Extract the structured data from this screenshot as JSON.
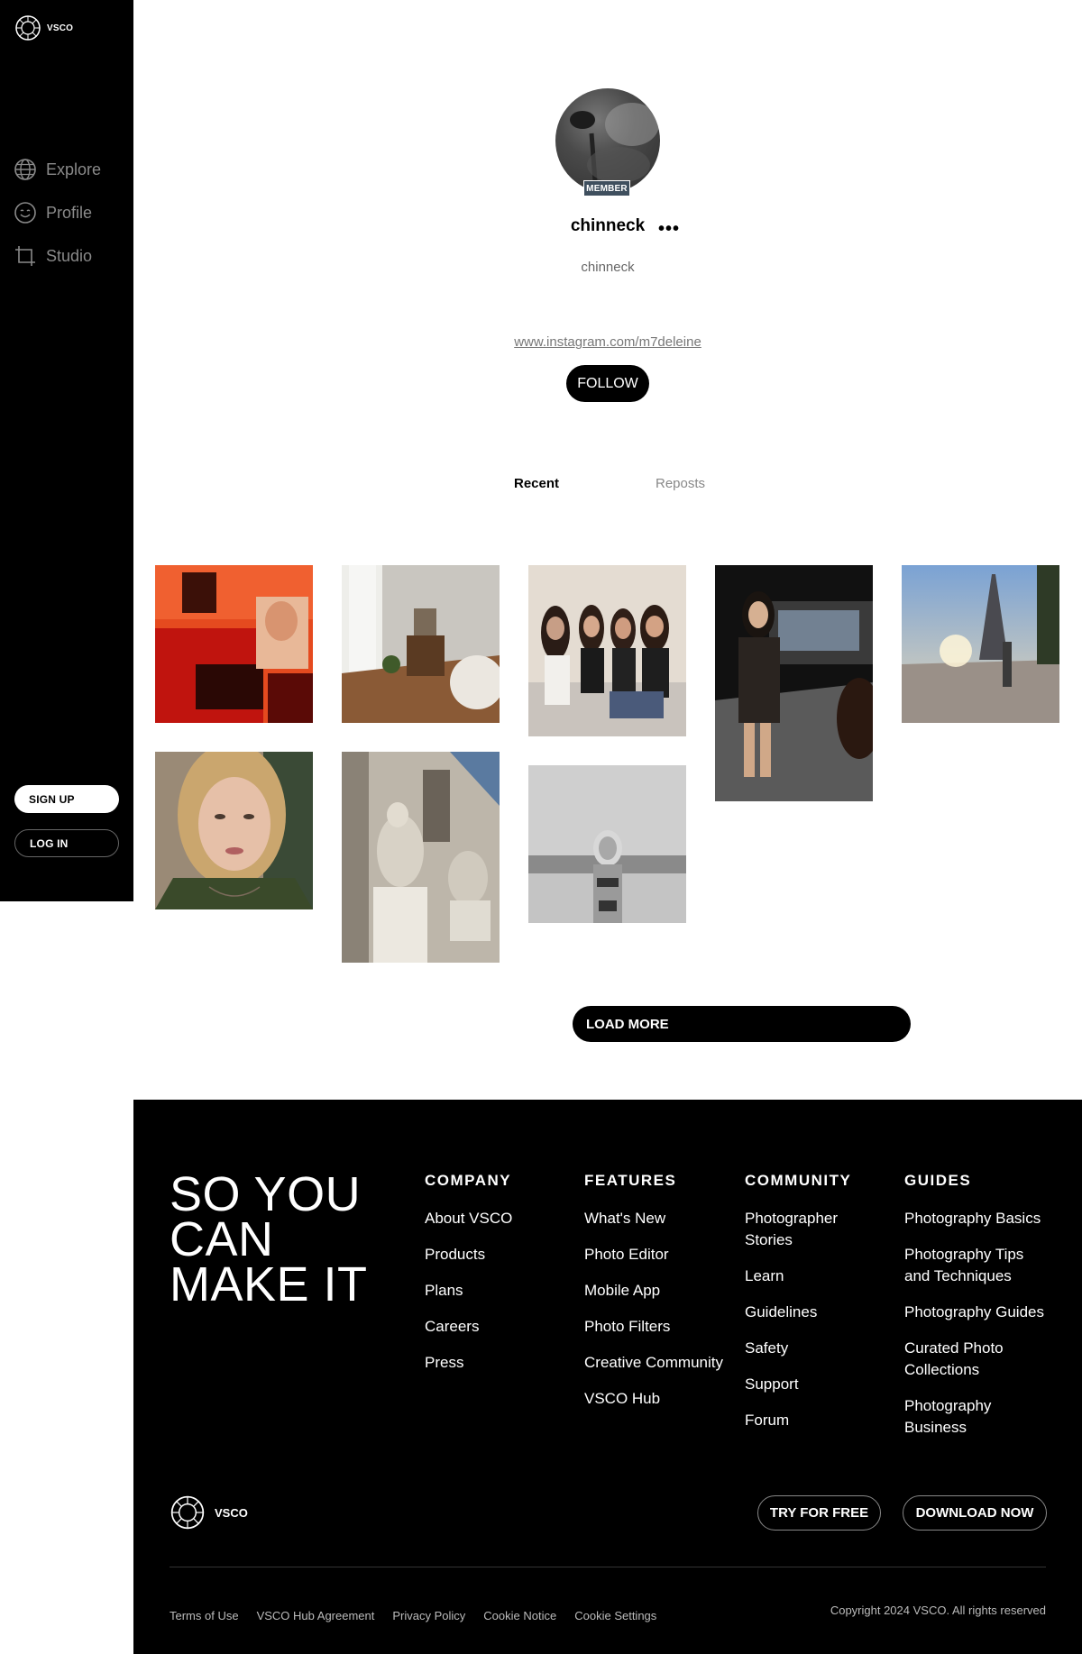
{
  "sidebar": {
    "brand": "VSCO",
    "nav": [
      {
        "label": "Explore",
        "icon": "globe-icon"
      },
      {
        "label": "Profile",
        "icon": "smiley-icon"
      },
      {
        "label": "Studio",
        "icon": "crop-icon"
      }
    ],
    "signup_label": "SIGN UP",
    "login_label": "LOG IN"
  },
  "profile": {
    "badge": "MEMBER",
    "username": "chinneck",
    "more_label": "•••",
    "display_name": "chinneck",
    "link": "www.instagram.com/m7deleine",
    "follow_label": "FOLLOW"
  },
  "tabs": {
    "recent": "Recent",
    "reposts": "Reposts"
  },
  "gallery": {
    "load_more_label": "LOAD MORE"
  },
  "footer": {
    "tagline": "SO YOU CAN MAKE IT",
    "columns": [
      {
        "heading": "COMPANY",
        "links": [
          "About VSCO",
          "Products",
          "Plans",
          "Careers",
          "Press"
        ]
      },
      {
        "heading": "FEATURES",
        "links": [
          "What's New",
          "Photo Editor",
          "Mobile App",
          "Photo Filters",
          "Creative Community",
          "VSCO Hub"
        ]
      },
      {
        "heading": "COMMUNITY",
        "links": [
          "Photographer Stories",
          "Learn",
          "Guidelines",
          "Safety",
          "Support",
          "Forum"
        ]
      },
      {
        "heading": "GUIDES",
        "links": [
          "Photography Basics",
          "Photography Tips and Techniques",
          "Photography Guides",
          "Curated Photo Collections",
          "Photography Business"
        ]
      }
    ],
    "brand": "VSCO",
    "try_label": "TRY FOR FREE",
    "download_label": "DOWNLOAD NOW",
    "legal": [
      "Terms of Use",
      "VSCO Hub Agreement",
      "Privacy Policy",
      "Cookie Notice",
      "Cookie Settings"
    ],
    "copyright": "Copyright 2024 VSCO. All rights reserved"
  }
}
